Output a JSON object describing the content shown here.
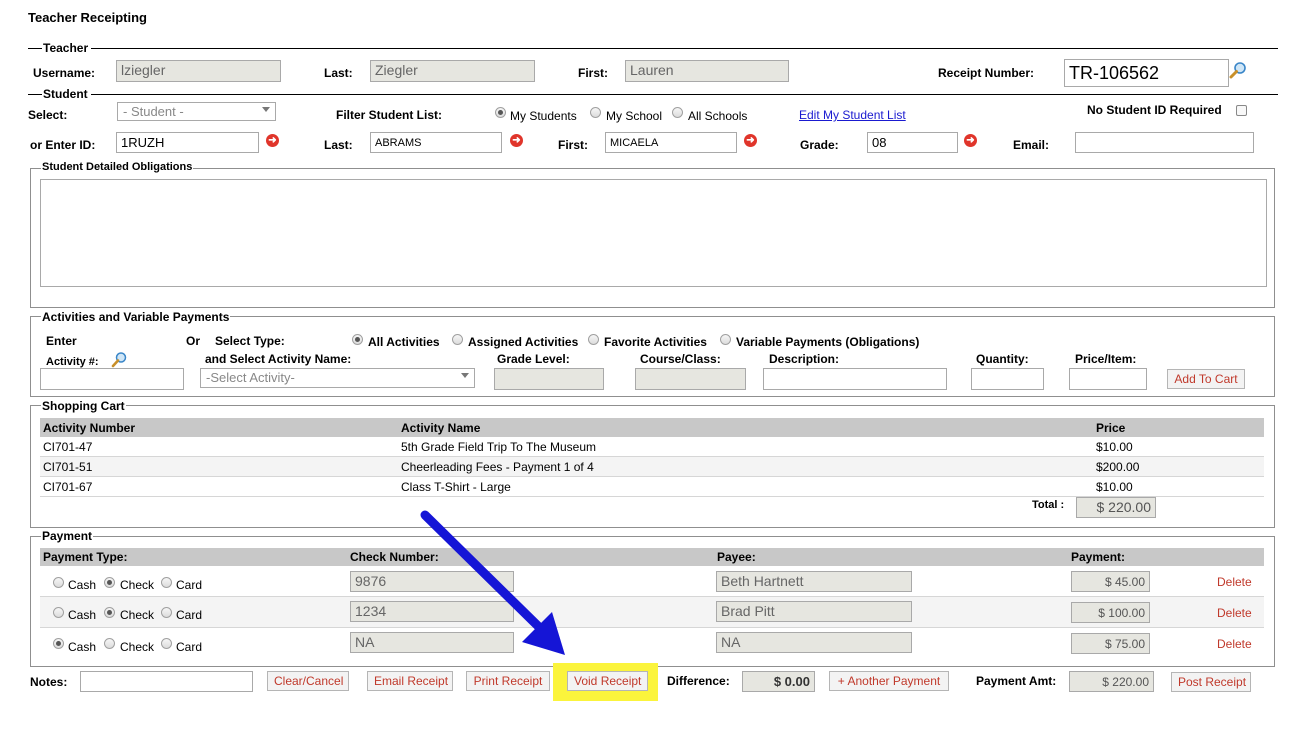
{
  "page_title": "Teacher Receipting",
  "teacher": {
    "legend": "Teacher",
    "username_label": "Username:",
    "username": "lziegler",
    "last_label": "Last:",
    "last": "Ziegler",
    "first_label": "First:",
    "first": "Lauren",
    "receipt_label": "Receipt Number:",
    "receipt": "TR-106562"
  },
  "student": {
    "legend": "Student",
    "select_label": "Select:",
    "select_value": "- Student -",
    "filter_label": "Filter Student List:",
    "filter_options": [
      "My Students",
      "My School",
      "All Schools"
    ],
    "edit_link": "Edit My Student List",
    "no_id_label": "No Student ID Required",
    "enter_id_label": "or Enter ID:",
    "id": "1RUZH",
    "last_label": "Last:",
    "last": "ABRAMS",
    "first_label": "First:",
    "first": "MICAELA",
    "grade_label": "Grade:",
    "grade": "08",
    "email_label": "Email:",
    "email": ""
  },
  "obligations": {
    "legend": "Student Detailed Obligations"
  },
  "activities": {
    "legend": "Activities and Variable Payments",
    "enter_label": "Enter",
    "activity_num_label": "Activity #:",
    "or_label": "Or",
    "select_type_label": "Select Type:",
    "type_options": [
      "All Activities",
      "Assigned Activities",
      "Favorite Activities",
      "Variable Payments (Obligations)"
    ],
    "select_name_label": "and Select Activity Name:",
    "select_placeholder": "-Select Activity-",
    "grade_level_label": "Grade Level:",
    "course_label": "Course/Class:",
    "description_label": "Description:",
    "quantity_label": "Quantity:",
    "price_label": "Price/Item:",
    "add_button": "Add To Cart"
  },
  "cart": {
    "legend": "Shopping Cart",
    "columns": [
      "Activity Number",
      "Activity Name",
      "Price"
    ],
    "rows": [
      {
        "num": "CI701-47",
        "name": "5th Grade Field Trip To The Museum",
        "price": "$10.00"
      },
      {
        "num": "CI701-51",
        "name": "Cheerleading Fees - Payment 1 of 4",
        "price": "$200.00"
      },
      {
        "num": "CI701-67",
        "name": "Class T-Shirt - Large",
        "price": "$10.00"
      }
    ],
    "total_label": "Total :",
    "total": "$ 220.00"
  },
  "payment": {
    "legend": "Payment",
    "columns": [
      "Payment Type:",
      "Check Number:",
      "Payee:",
      "Payment:"
    ],
    "type_options": [
      "Cash",
      "Check",
      "Card"
    ],
    "rows": [
      {
        "selected": "Check",
        "check": "9876",
        "payee": "Beth Hartnett",
        "amount": "$ 45.00",
        "delete": "Delete"
      },
      {
        "selected": "Check",
        "check": "1234",
        "payee": "Brad Pitt",
        "amount": "$ 100.00",
        "delete": "Delete"
      },
      {
        "selected": "Cash",
        "check": "NA",
        "payee": "NA",
        "amount": "$ 75.00",
        "delete": "Delete"
      }
    ]
  },
  "footer": {
    "notes_label": "Notes:",
    "notes": "",
    "clear": "Clear/Cancel",
    "email": "Email Receipt",
    "print": "Print Receipt",
    "void": "Void Receipt",
    "difference_label": "Difference:",
    "difference": "$ 0.00",
    "another": "+ Another Payment",
    "payment_amt_label": "Payment Amt:",
    "payment_amt": "$ 220.00",
    "post": "Post Receipt"
  },
  "colors": {
    "highlight": "#fbf43c",
    "arrow": "#1515d6",
    "link": "#1a1ad0",
    "button_text": "#c0392b"
  },
  "icons": {
    "search": "magnifier-icon",
    "clear": "red-circle-arrow-icon",
    "annotation": "blue-arrow-icon"
  }
}
